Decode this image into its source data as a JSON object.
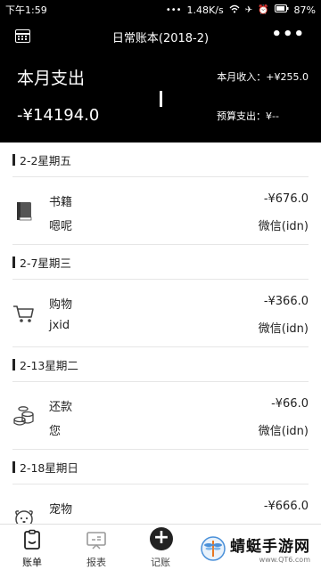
{
  "status_bar": {
    "time": "下午1:59",
    "speed": "1.48K/s",
    "battery": "87%"
  },
  "header": {
    "title": "日常账本(2018-2)",
    "more": "•••",
    "month_label": "本月支出",
    "month_amount": "-¥14194.0",
    "income": "本月收入：+¥255.0",
    "budget": "预算支出：¥--"
  },
  "groups": [
    {
      "date": "2-2星期五",
      "entries": [
        {
          "icon": "book-icon",
          "category": "书籍",
          "note": "嗯呢",
          "amount": "-¥676.0",
          "account": "微信(idn)"
        }
      ]
    },
    {
      "date": "2-7星期三",
      "entries": [
        {
          "icon": "shopping-cart-icon",
          "category": "购物",
          "note": "jxid",
          "amount": "-¥366.0",
          "account": "微信(idn)"
        }
      ]
    },
    {
      "date": "2-13星期二",
      "entries": [
        {
          "icon": "coins-icon",
          "category": "还款",
          "note": "您",
          "amount": "-¥66.0",
          "account": "微信(idn)"
        }
      ]
    },
    {
      "date": "2-18星期日",
      "entries": [
        {
          "icon": "pet-icon",
          "category": "宠物",
          "note": "",
          "amount": "-¥666.0",
          "account": ""
        }
      ]
    }
  ],
  "tabs": [
    {
      "label": "账单",
      "icon": "bill-icon",
      "active": true
    },
    {
      "label": "报表",
      "icon": "report-icon",
      "active": false
    },
    {
      "label": "记账",
      "icon": "add-icon",
      "active": false
    }
  ],
  "watermark": {
    "name": "蜻蜓手游网",
    "url": "www.QT6.com"
  }
}
